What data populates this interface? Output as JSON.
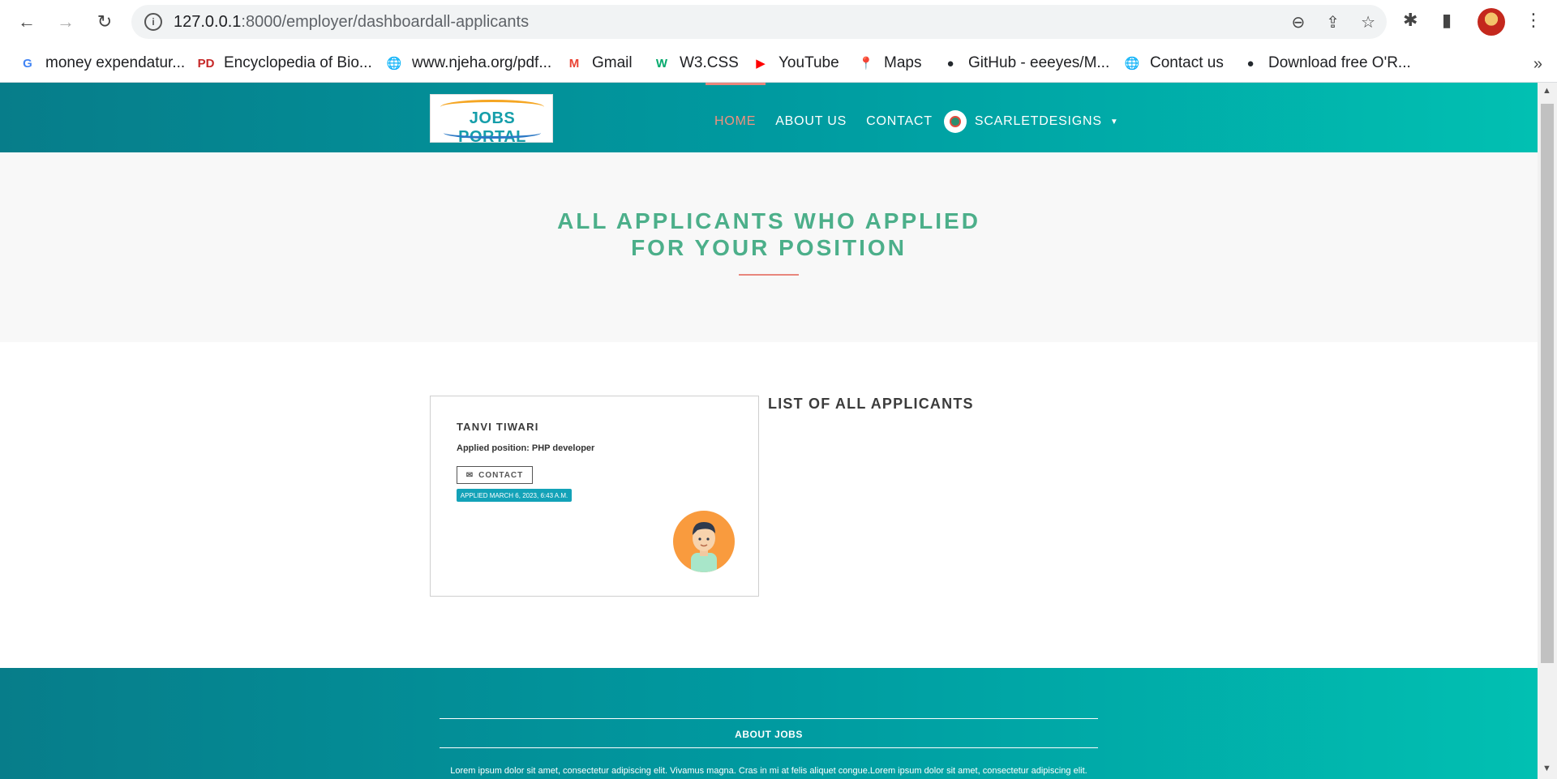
{
  "browser": {
    "url_host": "127.0.0.1",
    "url_path": ":8000/employer/dashboardall-applicants",
    "bookmarks": [
      {
        "label": "money expendatur...",
        "icon": "google-icon",
        "glyph": "G",
        "color": "#4285f4"
      },
      {
        "label": "Encyclopedia of Bio...",
        "icon": "pd-icon",
        "glyph": "PD",
        "color": "#c62828"
      },
      {
        "label": "www.njeha.org/pdf...",
        "icon": "globe-icon",
        "glyph": "🌐",
        "color": "#5f6368"
      },
      {
        "label": "Gmail",
        "icon": "gmail-icon",
        "glyph": "M",
        "color": "#ea4335"
      },
      {
        "label": "W3.CSS",
        "icon": "w3-icon",
        "glyph": "W",
        "color": "#04aa6d"
      },
      {
        "label": "YouTube",
        "icon": "youtube-icon",
        "glyph": "▶",
        "color": "#ff0000"
      },
      {
        "label": "Maps",
        "icon": "maps-icon",
        "glyph": "📍",
        "color": "#34a853"
      },
      {
        "label": "GitHub - eeeyes/M...",
        "icon": "github-icon",
        "glyph": "●",
        "color": "#24292e"
      },
      {
        "label": "Contact us",
        "icon": "globe-icon",
        "glyph": "🌐",
        "color": "#5f6368"
      },
      {
        "label": "Download free O'R...",
        "icon": "github-icon",
        "glyph": "●",
        "color": "#24292e"
      }
    ],
    "bookmarks_more": "»"
  },
  "site": {
    "logo_text": "JOBS PORTAL",
    "nav": {
      "home": "HOME",
      "about": "ABOUT US",
      "contact": "CONTACT",
      "user": "SCARLETDESIGNS"
    },
    "accent_color": "#e8867c",
    "brand_color": "#009aa0"
  },
  "hero": {
    "title_line1": "ALL APPLICANTS WHO APPLIED",
    "title_line2": "FOR YOUR POSITION"
  },
  "applicants": [
    {
      "name": "TANVI TIWARI",
      "position": "Applied position: PHP developer",
      "contact_label": "CONTACT",
      "applied": "APPLIED MARCH 6, 2023, 6:43 A.M."
    }
  ],
  "list_title": "LIST OF ALL APPLICANTS",
  "footer": {
    "title": "ABOUT JOBS",
    "text": "Lorem ipsum dolor sit amet, consectetur adipiscing elit. Vivamus magna. Cras in mi at felis aliquet congue.Lorem ipsum dolor sit amet, consectetur adipiscing elit."
  }
}
